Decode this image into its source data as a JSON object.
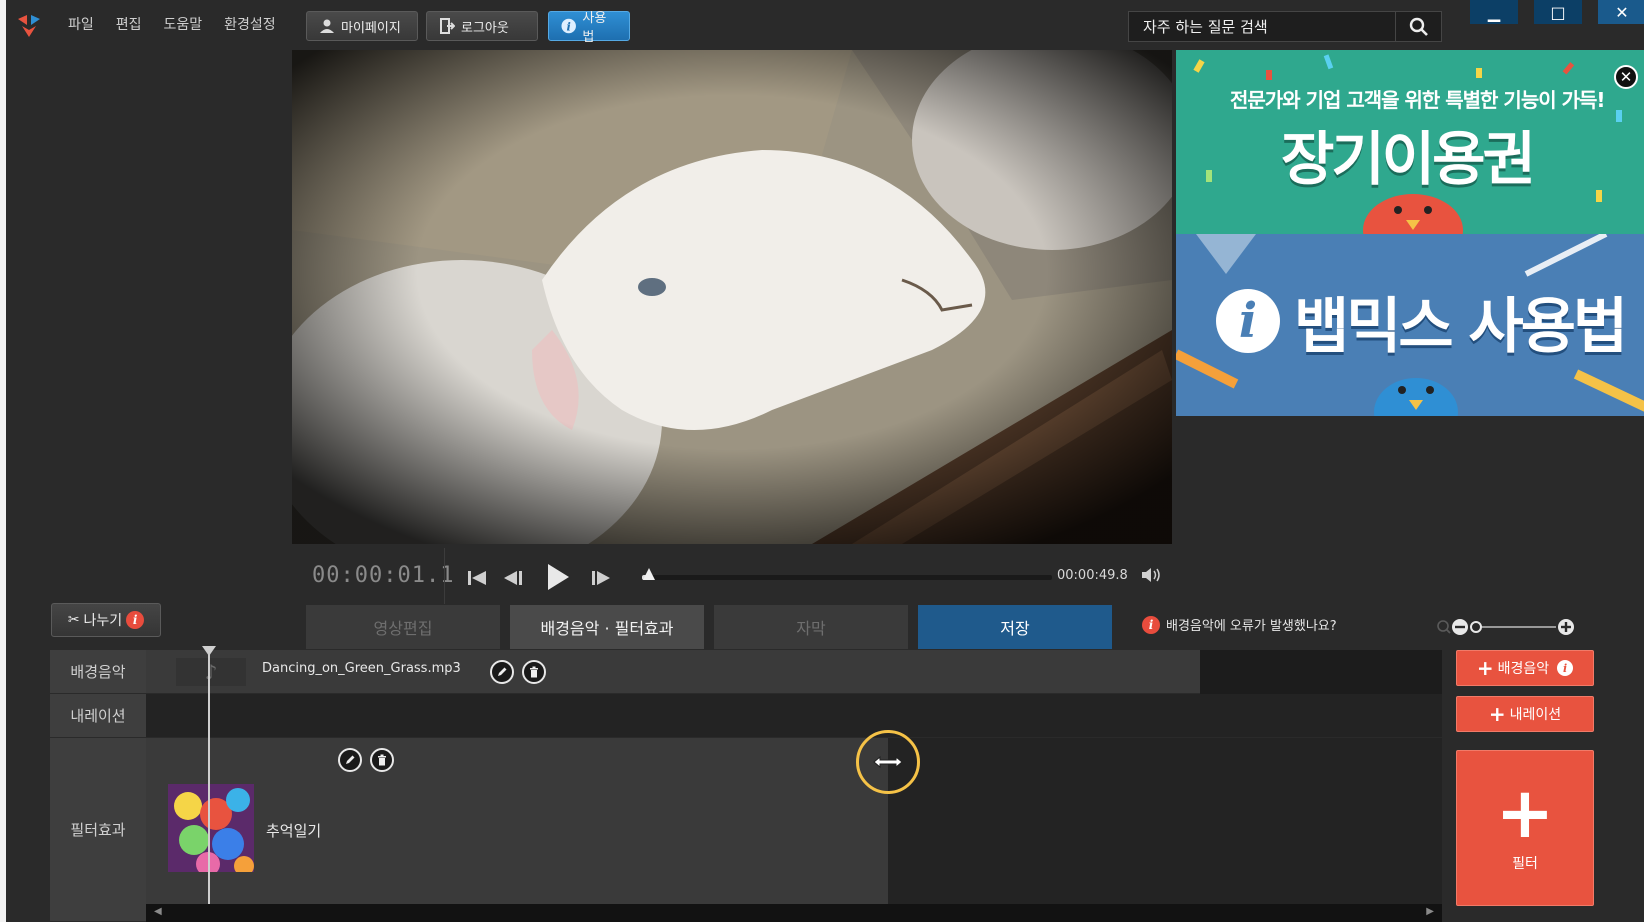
{
  "menu": [
    "파일",
    "편집",
    "도움말",
    "환경설정"
  ],
  "toolbar": {
    "mypage_label": "마이페이지",
    "logout_label": "로그아웃",
    "howto_label": "사용법"
  },
  "search": {
    "placeholder": "자주 하는 질문 검색"
  },
  "ads": {
    "banner1_sub": "전문가와 기업 고객을 위한 특별한 기능이 가득!",
    "banner1_title": "장기이용권",
    "banner2_title": "뱁믹스 사용법"
  },
  "player": {
    "current_time": "00:00:01.1",
    "end_time": "00:00:49.8",
    "progress_fraction": 0.016
  },
  "split_label": "나누기",
  "tabs": [
    "영상편집",
    "배경음악 · 필터효과",
    "자막",
    "저장"
  ],
  "active_tab": "저장",
  "error_link": "배경음악에 오류가 발생했나요?",
  "timeline": {
    "rows": [
      "배경음악",
      "내레이션",
      "필터효과"
    ],
    "music_file": "Dancing_on_Green_Grass.mp3",
    "filter_name": "추억일기"
  },
  "buttons": {
    "add_music": "배경음악",
    "add_narration": "내레이션",
    "add_filter": "필터"
  },
  "colors": {
    "accent_red": "#e8533f",
    "active_tab_blue": "#1f5a8c",
    "howto_blue": "#2f8fd4"
  }
}
